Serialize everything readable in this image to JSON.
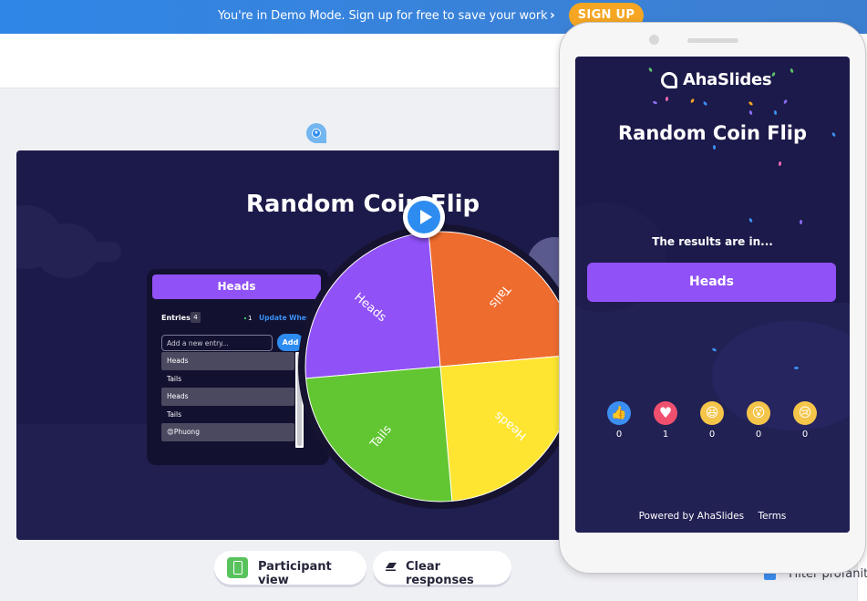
{
  "banner": {
    "message": "You're in Demo Mode. Sign up for free to save your work",
    "chevron": "›",
    "signup_label": "SIGN UP",
    "color": "#2f86e6",
    "signup_color": "#f6a623"
  },
  "slide": {
    "title": "Random Coin Flip",
    "background": "#1c1a4a",
    "panel": {
      "result": "Heads",
      "entries_label": "Entries",
      "entries_count": "4",
      "new_count": "1",
      "update_label": "Update Wheel",
      "input_placeholder": "Add a new entry...",
      "input_value": "",
      "add_label": "Add",
      "entries": [
        {
          "label": "Heads",
          "highlight": true
        },
        {
          "label": "Tails",
          "highlight": false
        },
        {
          "label": "Heads",
          "highlight": true
        },
        {
          "label": "Tails",
          "highlight": false
        },
        {
          "label": "😍Phuong",
          "highlight": true
        }
      ]
    },
    "wheel": {
      "segments": [
        {
          "label": "Heads",
          "color": "#9051f6"
        },
        {
          "label": "Tails",
          "color": "#ef6c2f"
        },
        {
          "label": "Heads",
          "color": "#fde532"
        },
        {
          "label": "Tails",
          "color": "#62c632"
        }
      ],
      "play_icon": "play-icon",
      "pointer_icon": "star-pin-icon"
    }
  },
  "actions": {
    "participant_view": "Participant view",
    "clear_responses": "Clear responses"
  },
  "settings": {
    "filter_profanity": "Filter profanity",
    "filter_profanity_checked": true
  },
  "phone": {
    "brand": "AhaSlides",
    "title": "Random Coin Flip",
    "results_label": "The results are in...",
    "result": "Heads",
    "reactions": [
      {
        "icon": "thumbs-up-icon",
        "glyph": "👍",
        "count": "0",
        "color": "#3b8ff2"
      },
      {
        "icon": "heart-icon",
        "glyph": "♥",
        "count": "1",
        "color": "#f0506e"
      },
      {
        "icon": "laughing-icon",
        "glyph": "😆",
        "count": "0",
        "color": "#f5c54a"
      },
      {
        "icon": "surprised-icon",
        "glyph": "😮",
        "count": "0",
        "color": "#f5c54a"
      },
      {
        "icon": "sad-icon",
        "glyph": "😢",
        "count": "0",
        "color": "#f5c54a"
      }
    ],
    "footer_powered": "Powered by AhaSlides",
    "footer_terms": "Terms"
  }
}
